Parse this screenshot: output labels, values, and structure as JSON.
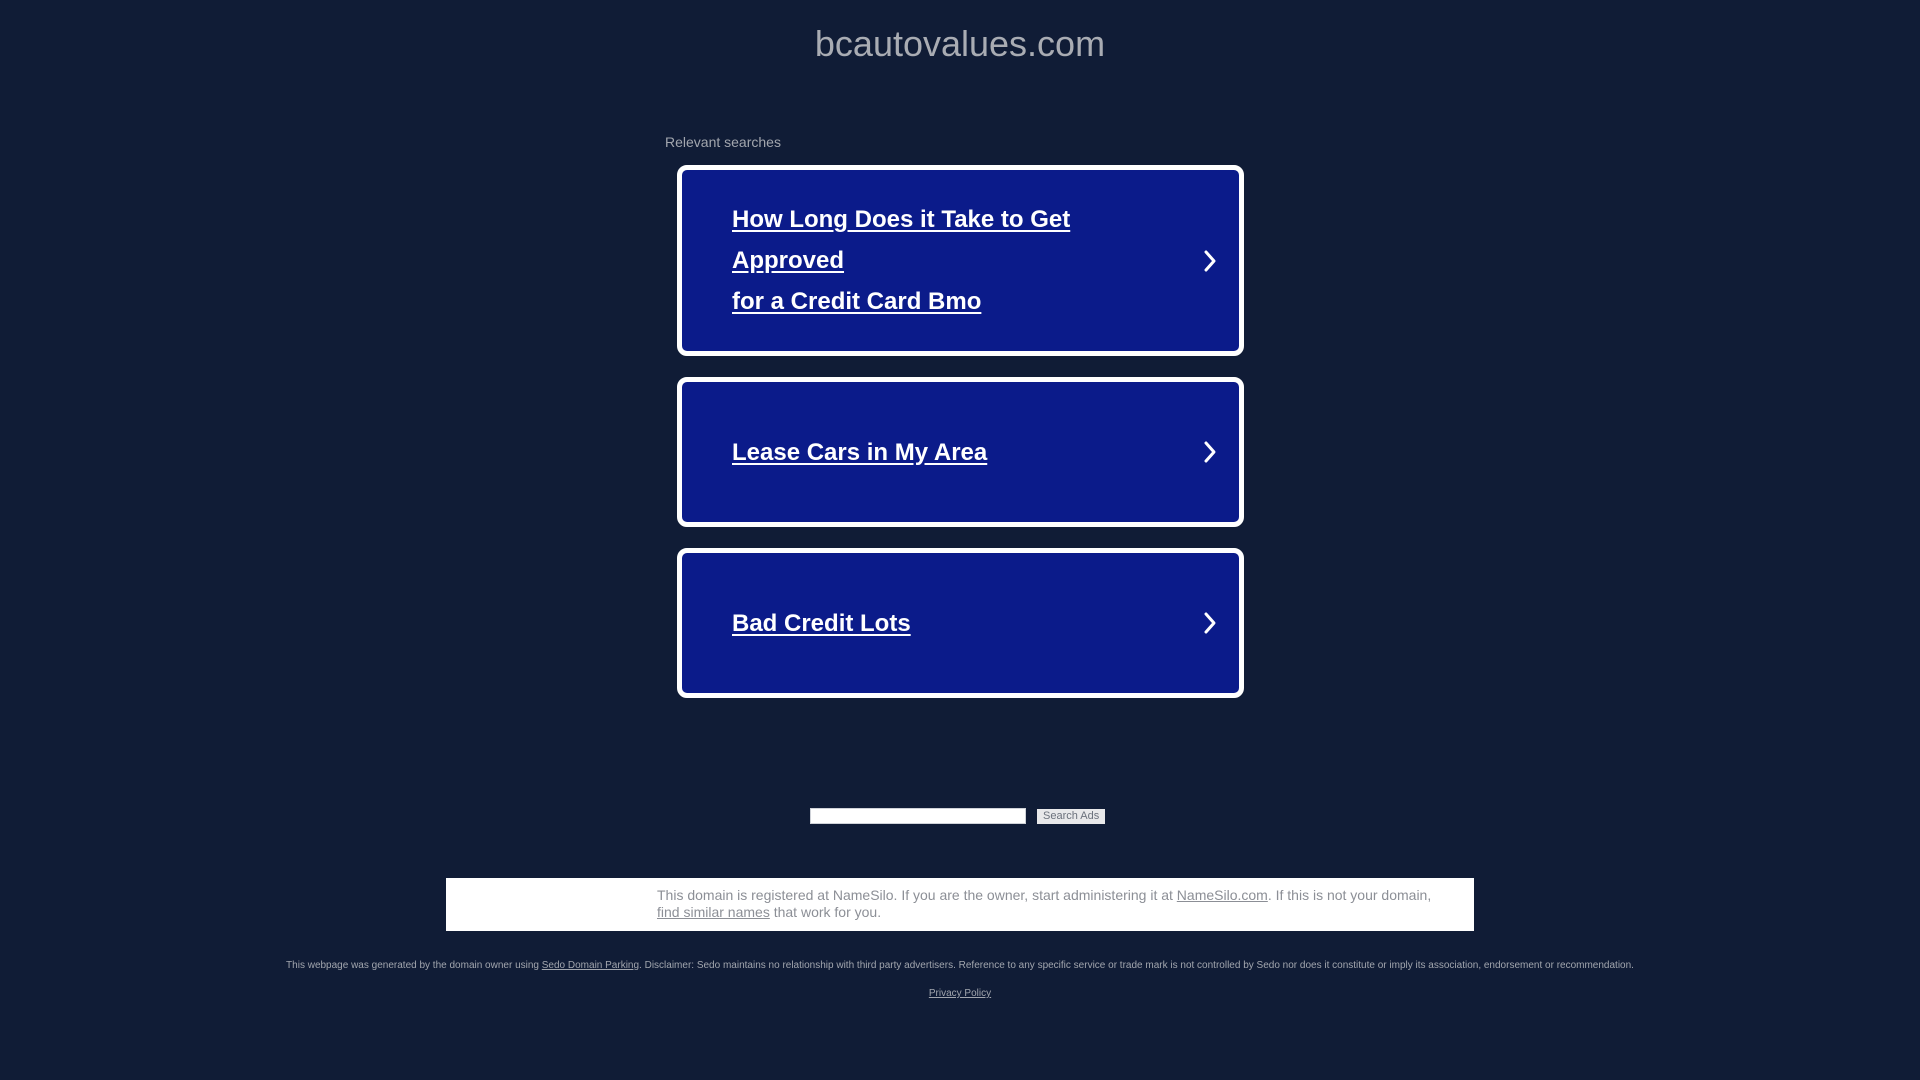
{
  "header": {
    "domain": "bcautovalues.com"
  },
  "relevant": {
    "label": "Relevant searches",
    "items": [
      {
        "label_line1": "How Long Does it Take to Get Approved",
        "label_line2": "for a Credit Card Bmo"
      },
      {
        "label": "Lease Cars in My Area"
      },
      {
        "label": "Bad Credit Lots"
      }
    ],
    "chevron_icon": "chevron-right-icon"
  },
  "search": {
    "input_value": "",
    "button_label": "Search Ads"
  },
  "notice": {
    "text_1": "This domain is registered at NameSilo. If you are the owner, start administering it at ",
    "link_1": "NameSilo.com",
    "text_2": ". If this is not your domain,",
    "link_2": "find similar names",
    "text_3": " that work for you."
  },
  "footer": {
    "text_1": "This webpage was generated by the domain owner using ",
    "link": "Sedo Domain Parking",
    "text_2": ". Disclaimer: Sedo maintains no relationship with third party advertisers. Reference to any specific service or trade mark is not controlled by Sedo nor does it constitute or imply its association, endorsement or recommendation.",
    "privacy_label": "Privacy Policy"
  },
  "colors": {
    "background": "#101c36",
    "card": "#0b1b8a",
    "card_border": "#ffffff"
  }
}
